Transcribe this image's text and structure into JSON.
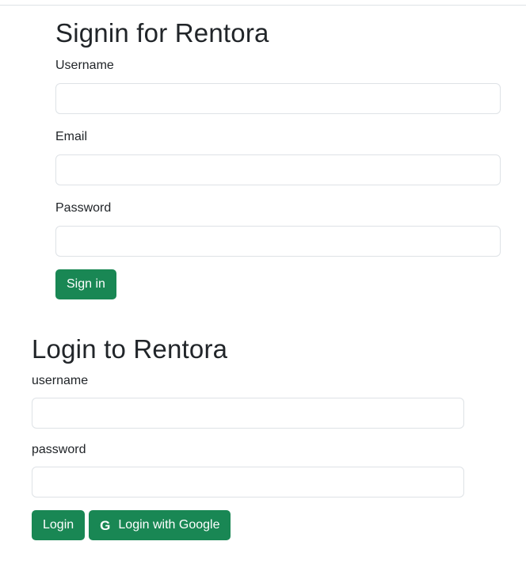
{
  "signin": {
    "title": "Signin for Rentora",
    "username_label": "Username",
    "username_value": "",
    "email_label": "Email",
    "email_value": "",
    "password_label": "Password",
    "password_value": "",
    "submit_label": "Sign in"
  },
  "login": {
    "title": "Login to Rentora",
    "username_label": "username",
    "username_value": "",
    "password_label": "password",
    "password_value": "",
    "submit_label": "Login",
    "google_label": "Login with Google",
    "google_icon": "google-icon"
  },
  "colors": {
    "primary_button": "#198754",
    "input_border": "#dee2e6",
    "text": "#212529"
  }
}
